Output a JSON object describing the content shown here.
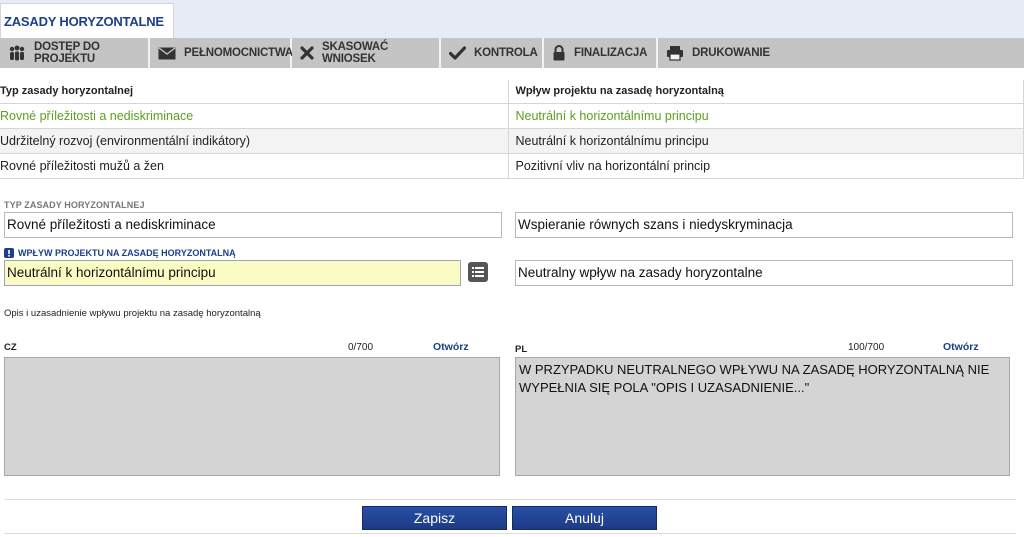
{
  "tab": {
    "title": "ZASADY HORYZONTALNE"
  },
  "toolbar": [
    {
      "label": "DOSTĘP DO PROJEKTU",
      "icon": "people-icon"
    },
    {
      "label": "PEŁNOMOCNICTWA",
      "icon": "envelope-icon"
    },
    {
      "label": "SKASOWAĆ WNIOSEK",
      "icon": "delete-x-icon"
    },
    {
      "label": "KONTROLA",
      "icon": "checkmark-icon"
    },
    {
      "label": "FINALIZACJA",
      "icon": "lock-icon"
    },
    {
      "label": "DRUKOWANIE",
      "icon": "printer-icon"
    }
  ],
  "table": {
    "headers": [
      "Typ zasady horyzontalnej",
      "Wpływ projektu na zasadę horyzontalną"
    ],
    "rows": [
      [
        "Rovné příležitosti a nediskriminace",
        "Neutrální k horizontálnímu principu"
      ],
      [
        "Udržitelný rozvoj (environmentální indikátory)",
        "Neutrální k horizontálnímu principu"
      ],
      [
        "Rovné příležitosti mužů a žen",
        "Pozitivní vliv na horizontální princip"
      ]
    ],
    "selected_row_color": "#5aa11d"
  },
  "form": {
    "type_label": "TYP ZASADY HORYZONTALNEJ",
    "type_value_cz": "Rovné příležitosti a nediskriminace",
    "type_value_pl": "Wspieranie równych szans i niedyskryminacja",
    "impact_label": "WPŁYW PROJEKTU NA ZASADĘ HORYZONTALNĄ",
    "impact_value_cz": "Neutrální k horizontálnímu principu",
    "impact_value_pl": "Neutralny wpływ na zasady horyzontalne",
    "description_label": "Opis i uzasadnienie wpływu projektu na zasadę horyzontalną",
    "cz": {
      "lang": "CZ",
      "count": "0/700",
      "open": "Otwórz",
      "text": ""
    },
    "pl": {
      "lang": "PL",
      "count": "100/700",
      "open": "Otwórz",
      "text": "W PRZYPADKU NEUTRALNEGO WPŁYWU NA ZASADĘ HORYZONTALNĄ NIE WYPEŁNIA SIĘ POLA \"OPIS I UZASADNIENIE...\""
    }
  },
  "buttons": {
    "save": "Zapisz",
    "cancel": "Anuluj"
  },
  "colors": {
    "accent": "#1b3f8b",
    "field_highlight": "#fbfbc4",
    "toolbar": "#c4c4c4"
  }
}
